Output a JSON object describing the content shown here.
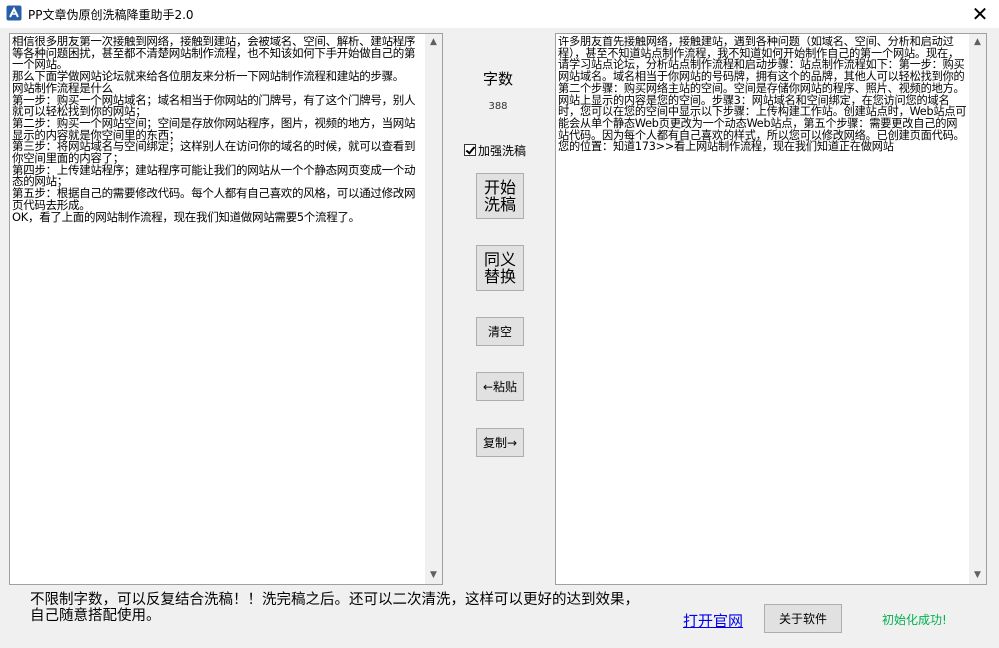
{
  "window": {
    "title": "PP文章伪原创洗稿降重助手2.0",
    "close_glyph": "✕"
  },
  "input_text": "相信很多朋友第一次接触到网络，接触到建站，会被域名、空间、解析、建站程序等各种问题困扰，甚至都不清楚网站制作流程，也不知该如何下手开始做自己的第一个网站。\n那么下面学做网站论坛就来给各位朋友来分析一下网站制作流程和建站的步骤。\n网站制作流程是什么\n第一步：购买一个网站域名；域名相当于你网站的门牌号，有了这个门牌号，别人就可以轻松找到你的网站；\n第二步：购买一个网站空间；空间是存放你网站程序，图片，视频的地方，当网站显示的内容就是你空间里的东西；\n第三步：将网站域名与空间绑定；这样别人在访问你的域名的时候，就可以查看到你空间里面的内容了；\n第四步：上传建站程序；建站程序可能让我们的网站从一个个静态网页变成一个动态的网站；\n第五步：根据自己的需要修改代码。每个人都有自己喜欢的风格，可以通过修改网页代码去形成。\nOK，看了上面的网站制作流程，现在我们知道做网站需要5个流程了。",
  "output_text": "许多朋友首先接触网络，接触建站，遇到各种问题（如域名、空间、分析和启动过程），甚至不知道站点制作流程，我不知道如何开始制作自己的第一个网站。现在，请学习站点论坛，分析站点制作流程和启动步骤：站点制作流程如下：第一步：购买网站域名。域名相当于你网站的号码牌，拥有这个的品牌，其他人可以轻松找到你的第二个步骤：购买网络主站的空间。空间是存储你网站的程序、照片、视频的地方。网站上显示的内容是您的空间。步骤3：网站域名和空间绑定，在您访问您的域名时，您可以在您的空间中显示以下步骤：上传构建工作站。创建站点时，Web站点可能会从单个静态Web页更改为一个动态Web站点，第五个步骤：需要更改自己的网站代码。因为每个人都有自己喜欢的样式，所以您可以修改网络。已创建页面代码。您的位置：知道173>>看上网站制作流程，现在我们知道正在做网站",
  "word_count": {
    "label": "字数",
    "value": "388"
  },
  "enhance_checkbox": {
    "label": "加强洗稿",
    "checked": true
  },
  "buttons": {
    "start": "开始洗稿",
    "replace": "同义替换",
    "clear": "清空",
    "paste": "←粘贴",
    "copy": "复制→",
    "about": "关于软件"
  },
  "footer": {
    "note": "不限制字数，可以反复结合洗稿！！洗完稿之后。还可以二次清洗，这样可以更好的达到效果，自己随意搭配使用。",
    "website_link": "打开官网",
    "status": "初始化成功!"
  },
  "scroll_icons": {
    "up": "▲",
    "down": "▼"
  },
  "colors": {
    "status_green": "#00b050",
    "link_blue": "#0000ee",
    "window_bg": "#f0f0f0"
  },
  "icons": {
    "app": "app-logo-icon",
    "close": "close-icon",
    "checkbox": "checkmark-icon"
  }
}
